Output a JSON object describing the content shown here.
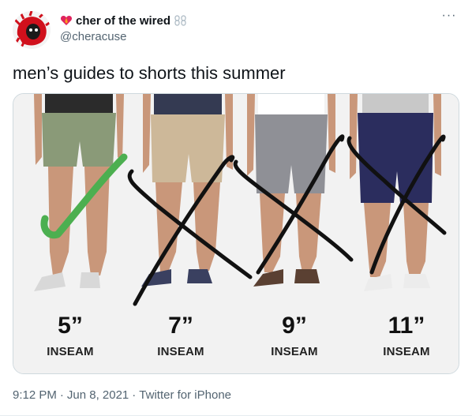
{
  "tweet": {
    "display_name": "cher of the wired",
    "handle": "@cheracuse",
    "text": "men’s guides to shorts this summer",
    "timestamp_time": "9:12 PM",
    "timestamp_date": "Jun 8, 2021",
    "separator": "·",
    "source": "Twitter for iPhone",
    "more_label": "···"
  },
  "image": {
    "columns": [
      {
        "size": "5”",
        "label": "INSEAM"
      },
      {
        "size": "7”",
        "label": "INSEAM"
      },
      {
        "size": "9”",
        "label": "INSEAM"
      },
      {
        "size": "11”",
        "label": "INSEAM"
      }
    ],
    "check_color": "#4caf50",
    "cross_color": "#111111"
  },
  "colors": {
    "text_primary": "#0f1419",
    "text_secondary": "#536471",
    "border": "#cfd9de"
  }
}
